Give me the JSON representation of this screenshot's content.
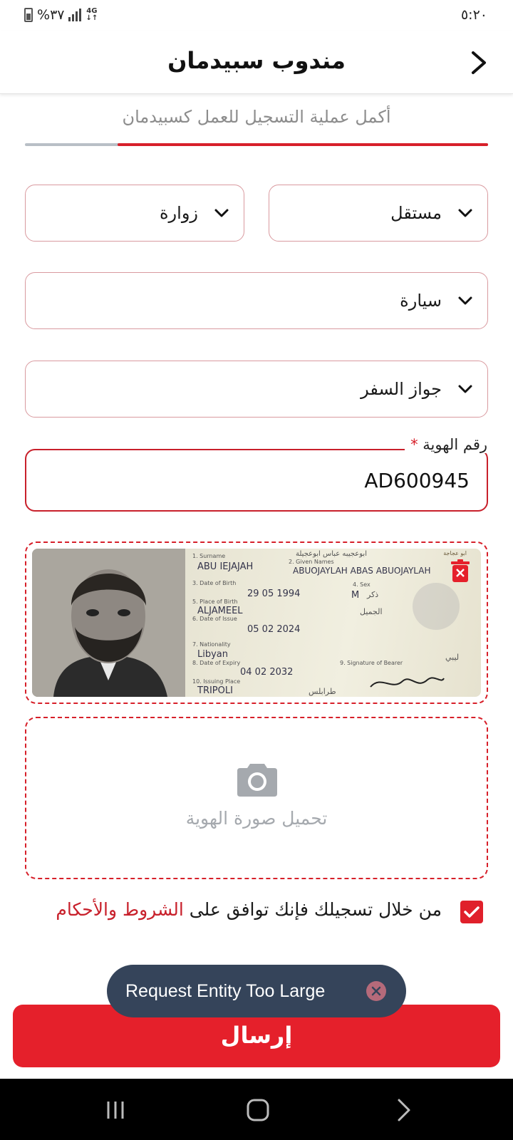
{
  "status_bar": {
    "time": "٥:٢٠",
    "battery": "%٣٧",
    "network": "4G"
  },
  "header": {
    "title": "مندوب سبيدمان"
  },
  "subtitle": "أكمل عملية التسجيل للعمل كسبيدمان",
  "progress": {
    "fraction": 0.8
  },
  "form": {
    "work_type": "مستقل",
    "city": "زوارة",
    "vehicle": "سيارة",
    "id_type": "جواز السفر",
    "id_number_label": "رقم الهوية",
    "id_number_required": "*",
    "id_number_value": "AD600945"
  },
  "passport": {
    "header_ar": "ابو عجاجة",
    "surname_label": "1. Surname",
    "surname": "ABU IEJAJAH",
    "name_ar": "ابوعجيبه عباس ابوعجيلة",
    "given_label": "2. Given Names",
    "given_names": "ABUOJAYLAH ABAS ABUOJAYLAH",
    "dob_label": "3. Date of Birth",
    "dob": "29 05 1994",
    "sex_label": "4. Sex",
    "sex": "M",
    "sex_ar": "ذكر",
    "pob_label": "5. Place of Birth",
    "pob": "ALJAMEEL",
    "pob_ar": "الجميل",
    "doi_label": "6. Date of Issue",
    "doi": "05 02 2024",
    "nationality_label": "7. Nationality",
    "nationality": "Libyan",
    "nationality_ar": "ليبي",
    "doe_label": "8. Date of Expiry",
    "doe": "04 02 2032",
    "signature_label": "9. Signature of Bearer",
    "issuing_label": "10. Issuing Place",
    "issuing": "TRIPOLI",
    "issuing_ar": "طرابلس"
  },
  "upload": {
    "label": "تحميل صورة الهوية"
  },
  "terms": {
    "text": "من خلال تسجيلك فإنك توافق على ",
    "link": "الشروط والأحكام",
    "checked": true
  },
  "toast": {
    "message": "Request Entity Too Large"
  },
  "submit": {
    "label": "إرسال"
  },
  "colors": {
    "accent": "#e5202b",
    "toast_bg": "#35445a",
    "placeholder": "#a5a9ae"
  },
  "icons": {
    "back": "chevron-right-icon",
    "dropdown": "chevron-down-icon",
    "delete": "trash-icon",
    "upload": "camera-icon",
    "toast_close": "close-icon",
    "nav": [
      "recent-apps-icon",
      "home-icon",
      "back-nav-icon"
    ]
  }
}
